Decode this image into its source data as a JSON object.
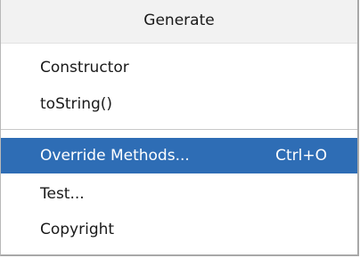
{
  "popup": {
    "title": "Generate",
    "items": [
      {
        "label": "Constructor"
      },
      {
        "label": "toString()"
      },
      {
        "label": "Override Methods...",
        "shortcut": "Ctrl+O",
        "selected": true
      },
      {
        "label": "Test..."
      },
      {
        "label": "Copyright"
      }
    ]
  },
  "colors": {
    "selection": "#2e6db5",
    "header_background": "#f2f2f2"
  }
}
